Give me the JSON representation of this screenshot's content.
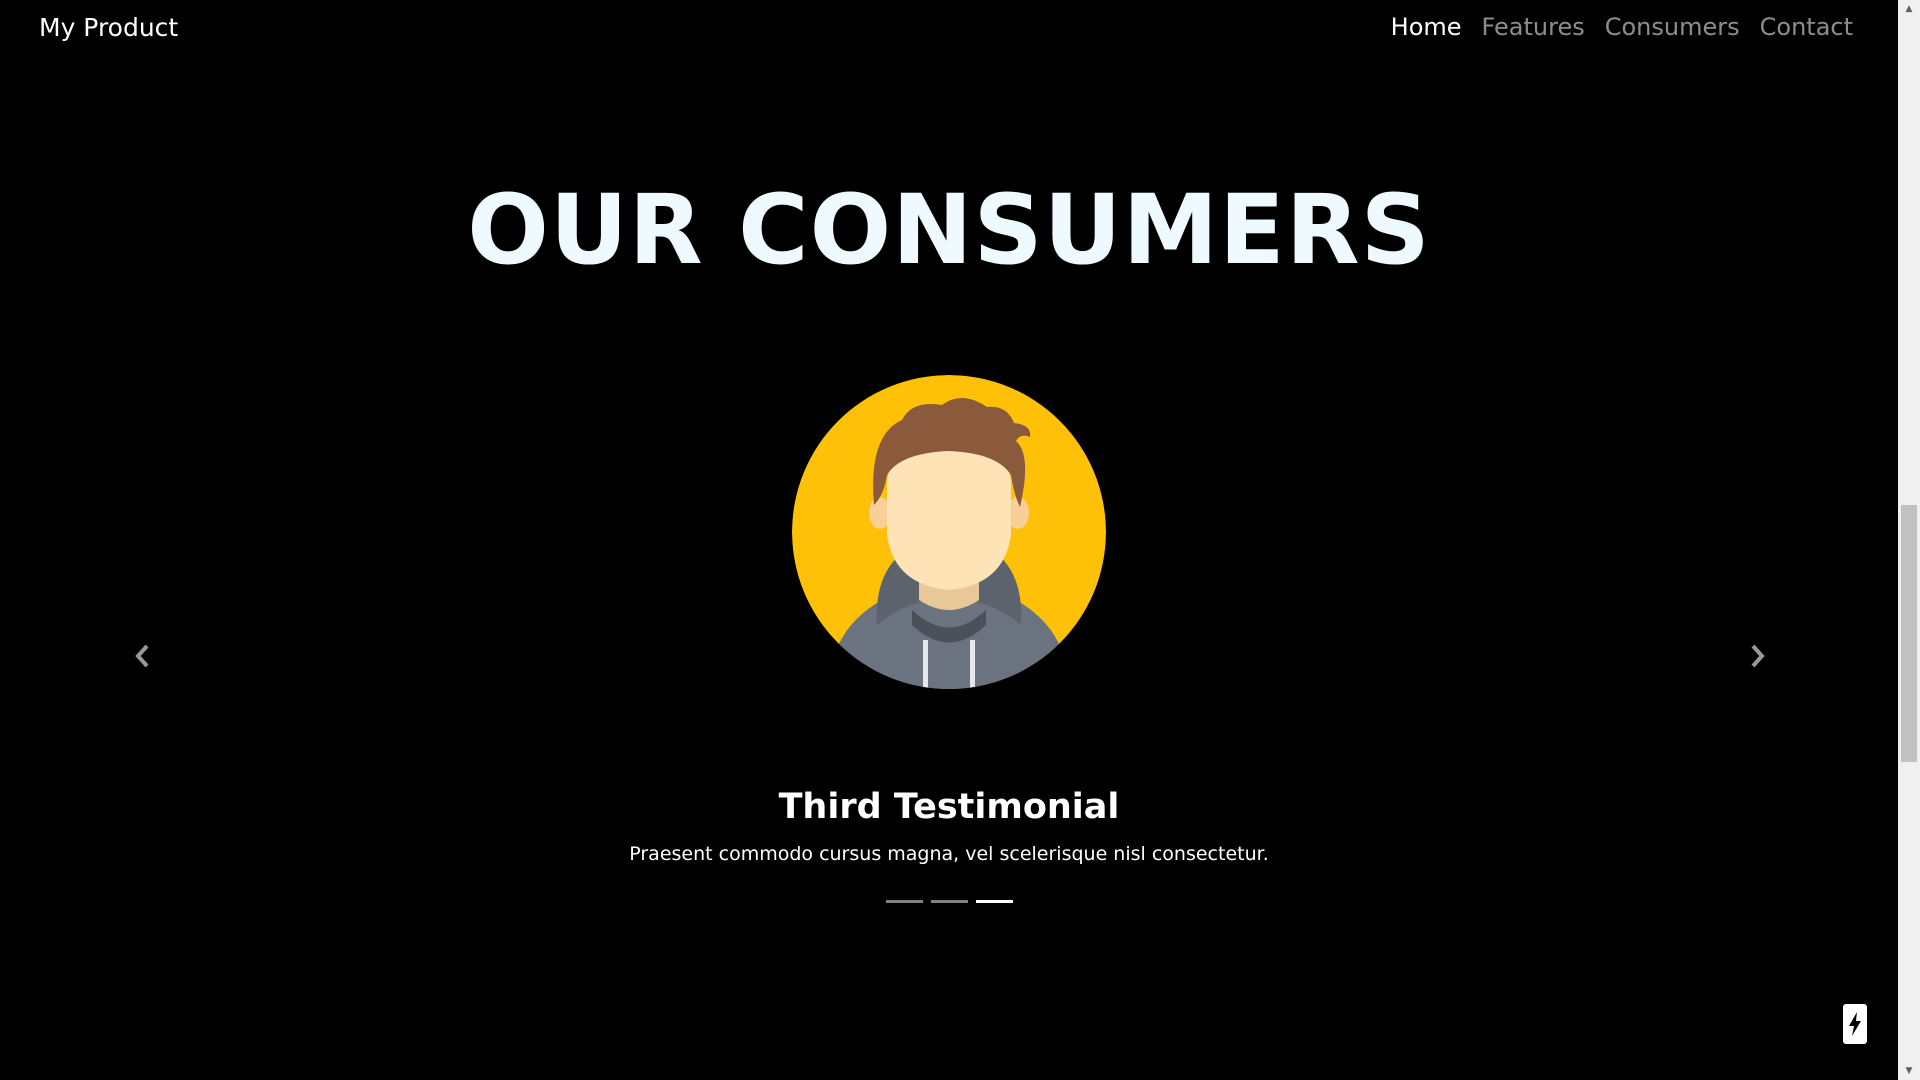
{
  "navbar": {
    "brand": "My Product",
    "links": [
      "Home",
      "Features",
      "Consumers",
      "Contact"
    ],
    "active": "Home"
  },
  "section": {
    "title": "OUR CONSUMERS"
  },
  "carousel": {
    "active_index": 2,
    "slide_count": 3,
    "caption_title": "Third Testimonial",
    "caption_text": "Praesent commodo cursus magna, vel scelerisque nisl consectetur.",
    "prev_icon": "chevron-left-icon",
    "next_icon": "chevron-right-icon"
  },
  "widget": {
    "icon": "lightning-bolt-icon"
  },
  "colors": {
    "background": "#000000",
    "title": "#eefaff",
    "avatar_bg": "#ffc107",
    "hair": "#8b5a3c",
    "skin": "#fde3b6",
    "hoodie": "#6b7280",
    "scrollbar_track": "#f0f0f0",
    "scrollbar_thumb": "#c1c1c1"
  }
}
